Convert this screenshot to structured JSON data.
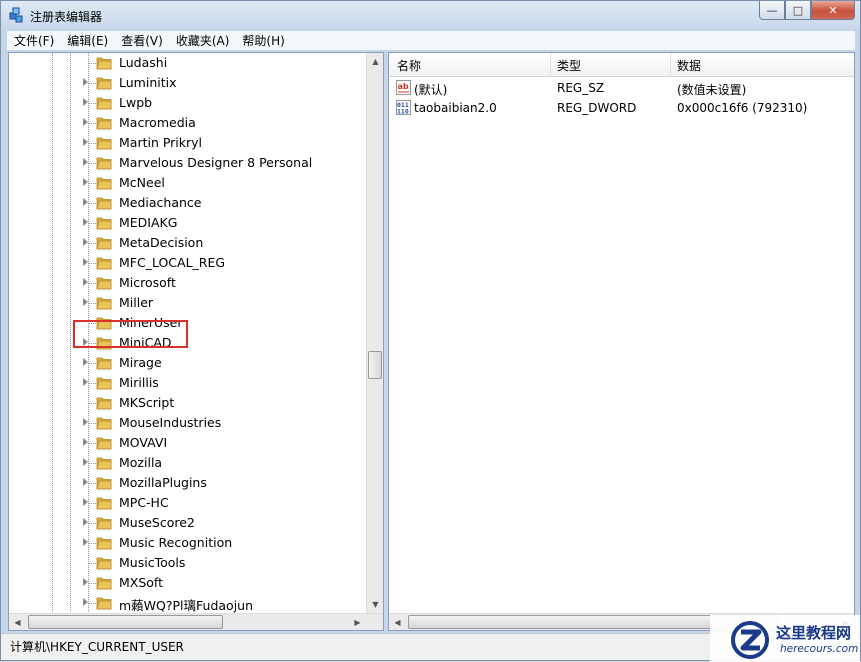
{
  "window": {
    "title": "注册表编辑器",
    "caption": {
      "minimize": "—",
      "maximize": "□",
      "close": "✕"
    }
  },
  "menubar": {
    "items": [
      "文件(F)",
      "编辑(E)",
      "查看(V)",
      "收藏夹(A)",
      "帮助(H)"
    ]
  },
  "tree": {
    "nodes": [
      {
        "label": "Ludashi",
        "expandable": false
      },
      {
        "label": "Luminitix",
        "expandable": true
      },
      {
        "label": "Lwpb",
        "expandable": true
      },
      {
        "label": "Macromedia",
        "expandable": true
      },
      {
        "label": "Martin Prikryl",
        "expandable": true
      },
      {
        "label": "Marvelous Designer 8 Personal",
        "expandable": true
      },
      {
        "label": "McNeel",
        "expandable": true
      },
      {
        "label": "Mediachance",
        "expandable": true
      },
      {
        "label": "MEDIAKG",
        "expandable": true
      },
      {
        "label": "MetaDecision",
        "expandable": true
      },
      {
        "label": "MFC_LOCAL_REG",
        "expandable": true
      },
      {
        "label": "Microsoft",
        "expandable": true,
        "highlighted": true
      },
      {
        "label": "Miller",
        "expandable": true
      },
      {
        "label": "MinerUser",
        "expandable": false
      },
      {
        "label": "MiniCAD",
        "expandable": true
      },
      {
        "label": "Mirage",
        "expandable": true
      },
      {
        "label": "Mirillis",
        "expandable": true
      },
      {
        "label": "MKScript",
        "expandable": false
      },
      {
        "label": "MouseIndustries",
        "expandable": true
      },
      {
        "label": "MOVAVI",
        "expandable": true
      },
      {
        "label": "Mozilla",
        "expandable": true
      },
      {
        "label": "MozillaPlugins",
        "expandable": true
      },
      {
        "label": "MPC-HC",
        "expandable": true
      },
      {
        "label": "MuseScore2",
        "expandable": true
      },
      {
        "label": "Music Recognition",
        "expandable": true
      },
      {
        "label": "MusicTools",
        "expandable": false
      },
      {
        "label": "MXSoft",
        "expandable": true
      },
      {
        "label": "m藾WQ?Pl璃Fudaojun",
        "expandable": true
      }
    ]
  },
  "values": {
    "columns": [
      "名称",
      "类型",
      "数据"
    ],
    "rows": [
      {
        "icon": "string-value-icon",
        "name": "(默认)",
        "type": "REG_SZ",
        "data": "(数值未设置)"
      },
      {
        "icon": "binary-value-icon",
        "name": "taobaibian2.0",
        "type": "REG_DWORD",
        "data": "0x000c16f6 (792310)"
      }
    ]
  },
  "statusbar": {
    "path": "计算机\\HKEY_CURRENT_USER"
  },
  "logo": {
    "title": "这里教程网",
    "url": "herecours.com"
  },
  "colors": {
    "highlight": "#d9302c",
    "folder": "#e8c45a",
    "logo": "#1a3a8a"
  }
}
